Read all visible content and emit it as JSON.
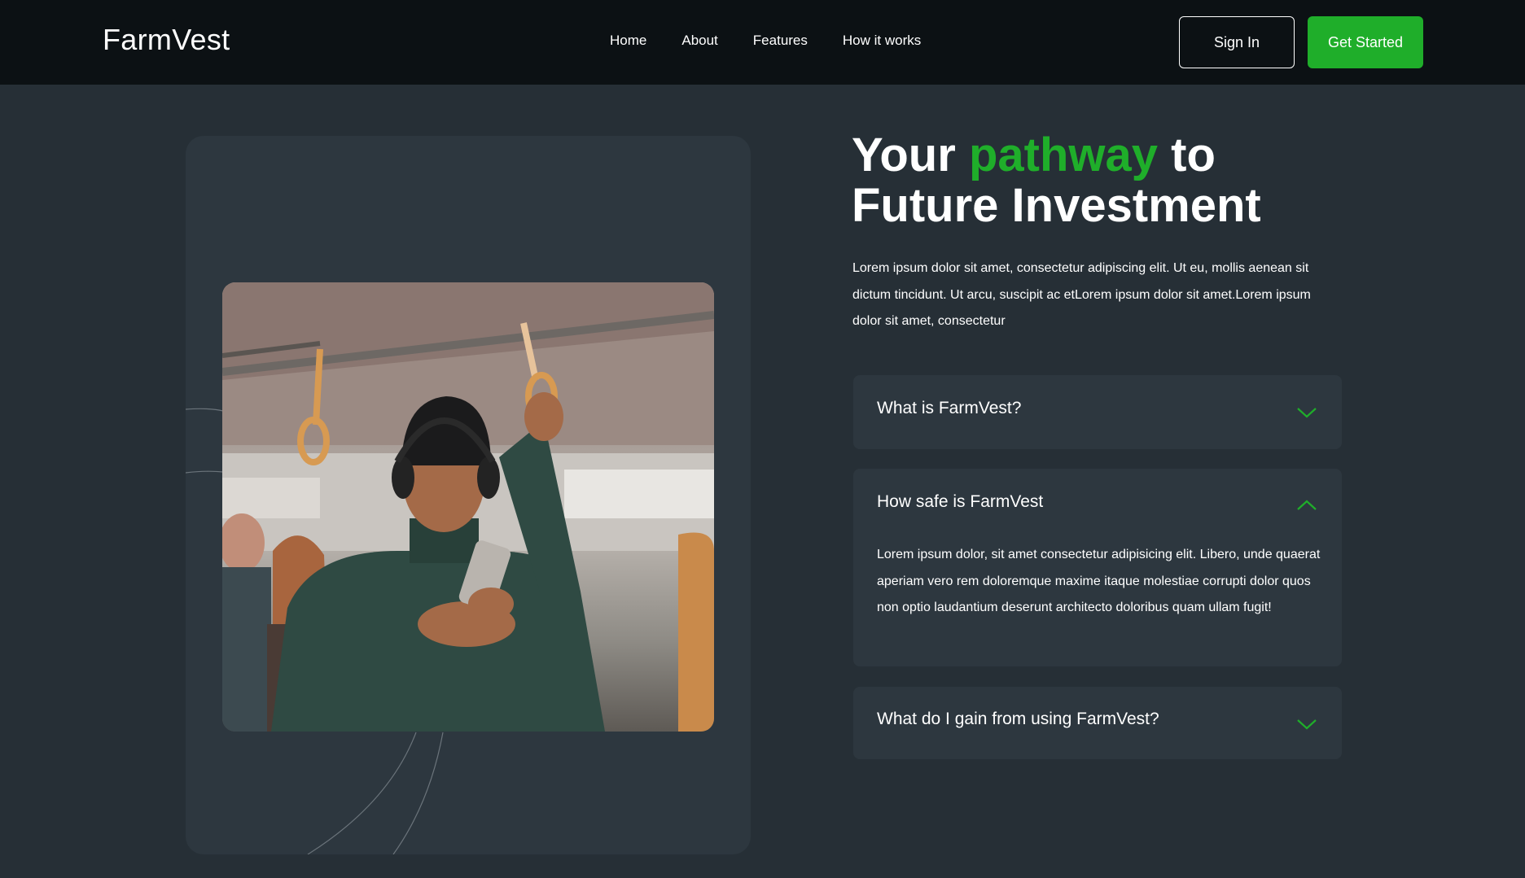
{
  "brand": {
    "name": "FarmVest",
    "accent_color": "#1fae2a"
  },
  "nav": {
    "links": [
      "Home",
      "About",
      "Features",
      "How it works"
    ],
    "sign_in": "Sign In",
    "get_started": "Get Started"
  },
  "hero": {
    "title_part1": "Your",
    "title_accent": "pathway",
    "title_part2": "to",
    "title_line2": "Future Investment",
    "description": "Lorem ipsum dolor sit amet, consectetur adipiscing elit. Ut eu, mollis aenean sit dictum tincidunt. Ut arcu, suscipit ac etLorem ipsum dolor sit amet.Lorem ipsum dolor sit amet, consectetur"
  },
  "media": {
    "icon": "photo-person-on-train"
  },
  "faq": [
    {
      "question": "What is FarmVest?",
      "expanded": false,
      "icon": "chevron-down-icon"
    },
    {
      "question": "How safe is FarmVest",
      "expanded": true,
      "icon": "chevron-up-icon",
      "answer": "Lorem ipsum dolor, sit amet consectetur adipisicing elit. Libero, unde quaerat aperiam vero rem doloremque maxime itaque molestiae corrupti dolor quos non optio laudantium deserunt architecto doloribus quam ullam fugit!"
    },
    {
      "question": "What do I gain from using FarmVest?",
      "expanded": false,
      "icon": "chevron-down-icon"
    }
  ]
}
